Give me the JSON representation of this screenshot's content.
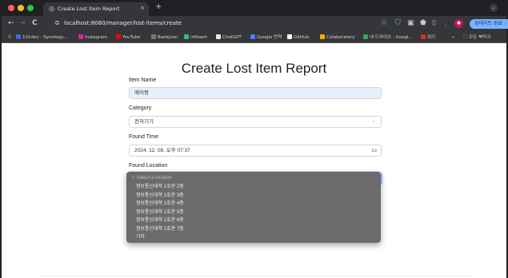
{
  "browser": {
    "tab": {
      "title": "Create Lost Item Report",
      "close": "×"
    },
    "new_tab": "+",
    "tabstrip_menu": "⌄",
    "nav": {
      "back": "←",
      "forward": "→",
      "reload": "C"
    },
    "url": "localhost:8080/manager/lost-items/create",
    "update_button": "업데이트 완료 ⋮",
    "bookmarks": [
      {
        "label": "101dev - Synology...",
        "color": "#3a6fd8"
      },
      {
        "label": "Instagram",
        "color": "#d6249f"
      },
      {
        "label": "YouTube",
        "color": "#ff0000"
      },
      {
        "label": "Baekjoon",
        "color": "#777777"
      },
      {
        "label": "inflearn",
        "color": "#2fbf71"
      },
      {
        "label": "ChatGPT",
        "color": "#e8e8e8"
      },
      {
        "label": "Google 번역",
        "color": "#4285f4"
      },
      {
        "label": "GitHub",
        "color": "#ffffff"
      },
      {
        "label": "Colaboratory",
        "color": "#f9ab00"
      },
      {
        "label": "내 드라이브 - Googl...",
        "color": "#34a853"
      },
      {
        "label": "위키",
        "color": "#d93025"
      }
    ],
    "bookmarks_more": "»",
    "all_bookmarks": "모든 북마크"
  },
  "form": {
    "title": "Create Lost Item Report",
    "item_name": {
      "label": "Item Name",
      "value": "에어팟"
    },
    "category": {
      "label": "Category",
      "value": "전자기기"
    },
    "found_time": {
      "label": "Found Time",
      "value": "2024. 12. 08. 오후 07:37"
    },
    "found_location": {
      "label": "Found Location"
    }
  },
  "location_dropdown": {
    "placeholder": "Select a location",
    "options": [
      "정보통신대학 1호관 2층",
      "정보통신대학 1호관 3층",
      "정보통신대학 1호관 4층",
      "정보통신대학 1호관 5층",
      "정보통신대학 1호관 6층",
      "정보통신대학 1호관 7층",
      "기타"
    ]
  }
}
